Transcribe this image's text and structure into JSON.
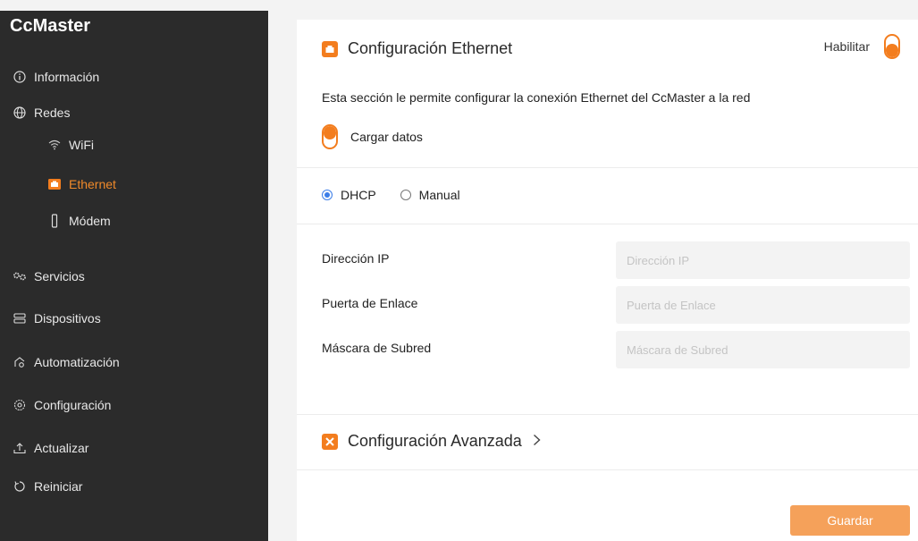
{
  "sidebar": {
    "brand": "CcMaster",
    "items": {
      "informacion": "Información",
      "redes": "Redes",
      "wifi": "WiFi",
      "ethernet": "Ethernet",
      "modem": "Módem",
      "servicios": "Servicios",
      "dispositivos": "Dispositivos",
      "automatizacion": "Automatización",
      "configuracion": "Configuración",
      "actualizar": "Actualizar",
      "reiniciar": "Reiniciar"
    },
    "active": "ethernet"
  },
  "main": {
    "title": "Configuración Ethernet",
    "enable_label": "Habilitar",
    "description": "Esta sección le permite configurar la conexión Ethernet del CcMaster a la red",
    "load_label": "Cargar datos",
    "mode": {
      "dhcp": "DHCP",
      "manual": "Manual",
      "selected": "DHCP"
    },
    "fields": {
      "ip": {
        "label": "Dirección IP",
        "placeholder": "Dirección IP",
        "value": ""
      },
      "gateway": {
        "label": "Puerta de Enlace",
        "placeholder": "Puerta de Enlace",
        "value": ""
      },
      "mask": {
        "label": "Máscara de Subred",
        "placeholder": "Máscara de Subred",
        "value": ""
      }
    },
    "advanced_label": "Configuración Avanzada",
    "save_label": "Guardar"
  },
  "colors": {
    "accent": "#f37d1e",
    "sidebar_bg": "#2b2b2b",
    "radio_selected": "#3b7de8",
    "save_button": "#f5a15a"
  }
}
